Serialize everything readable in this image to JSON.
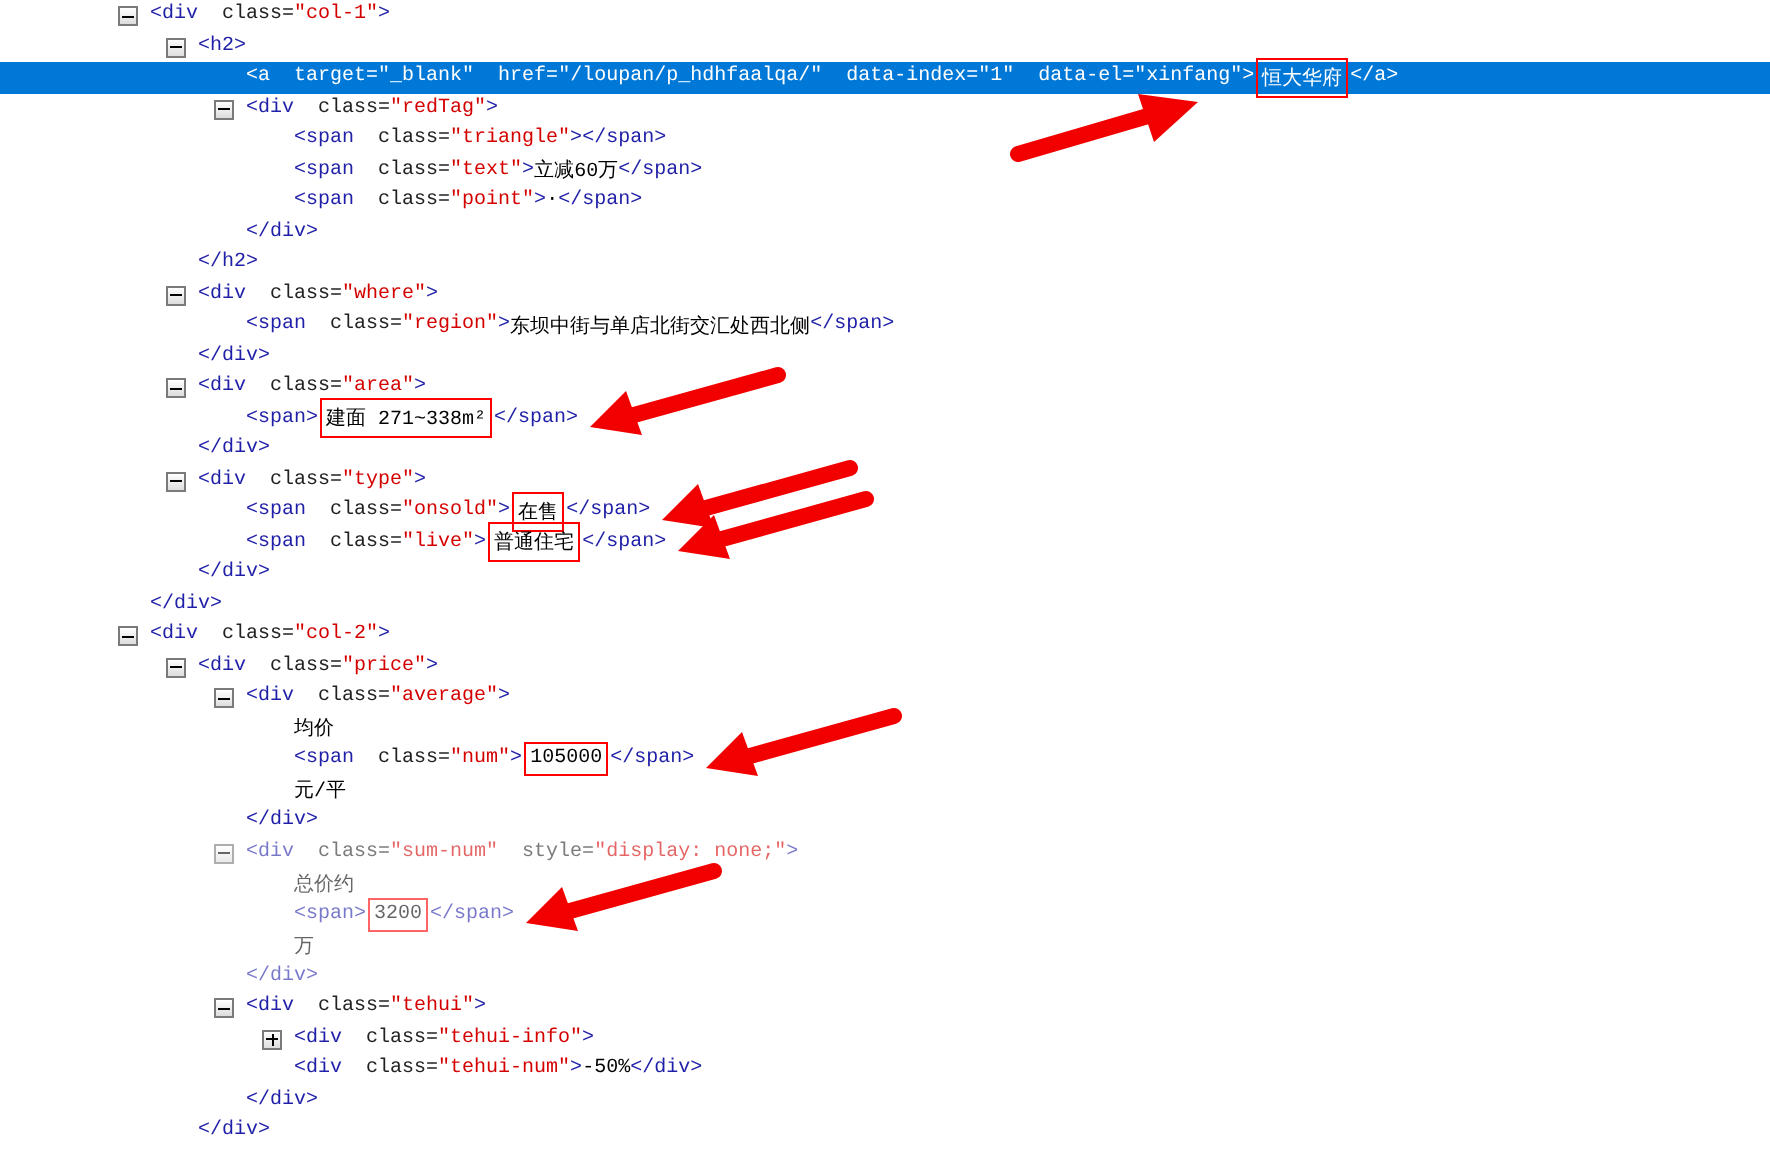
{
  "tree": [
    {
      "selected": false,
      "expanded": true,
      "open": [
        {
          "kind": "tag",
          "text": "<div"
        },
        {
          "kind": "attr",
          "text": "class="
        },
        {
          "kind": "value",
          "text": "\"col-1\""
        },
        {
          "kind": "tag",
          "text": ">"
        }
      ],
      "children": [
        {
          "selected": false,
          "expanded": true,
          "open": [
            {
              "kind": "tag",
              "text": "<h2>"
            }
          ],
          "children": [
            {
              "selected": true,
              "open": [
                {
                  "kind": "tag",
                  "text": "<a"
                },
                {
                  "kind": "attr",
                  "text": "target="
                },
                {
                  "kind": "value",
                  "text": "\"_blank\""
                },
                {
                  "kind": "attr",
                  "text": "href="
                },
                {
                  "kind": "value",
                  "text": "\"/loupan/p_hdhfaalqa/\""
                },
                {
                  "kind": "attr",
                  "text": "data-index="
                },
                {
                  "kind": "value",
                  "text": "\"1\""
                },
                {
                  "kind": "attr",
                  "text": "data-el="
                },
                {
                  "kind": "value",
                  "text": "\"xinfang\""
                },
                {
                  "kind": "tag",
                  "text": ">"
                },
                {
                  "kind": "text",
                  "text": "恒大华府",
                  "boxed": true
                },
                {
                  "kind": "tag",
                  "text": "</a>"
                }
              ]
            },
            {
              "selected": false,
              "expanded": true,
              "open": [
                {
                  "kind": "tag",
                  "text": "<div"
                },
                {
                  "kind": "attr",
                  "text": "class="
                },
                {
                  "kind": "value",
                  "text": "\"redTag\""
                },
                {
                  "kind": "tag",
                  "text": ">"
                }
              ],
              "children": [
                {
                  "selected": false,
                  "open": [
                    {
                      "kind": "tag",
                      "text": "<span"
                    },
                    {
                      "kind": "attr",
                      "text": "class="
                    },
                    {
                      "kind": "value",
                      "text": "\"triangle\""
                    },
                    {
                      "kind": "tag",
                      "text": ">"
                    },
                    {
                      "kind": "tag",
                      "text": "</span>"
                    }
                  ]
                },
                {
                  "selected": false,
                  "open": [
                    {
                      "kind": "tag",
                      "text": "<span"
                    },
                    {
                      "kind": "attr",
                      "text": "class="
                    },
                    {
                      "kind": "value",
                      "text": "\"text\""
                    },
                    {
                      "kind": "tag",
                      "text": ">"
                    },
                    {
                      "kind": "text",
                      "text": "立减60万"
                    },
                    {
                      "kind": "tag",
                      "text": "</span>"
                    }
                  ]
                },
                {
                  "selected": false,
                  "open": [
                    {
                      "kind": "tag",
                      "text": "<span"
                    },
                    {
                      "kind": "attr",
                      "text": "class="
                    },
                    {
                      "kind": "value",
                      "text": "\"point\""
                    },
                    {
                      "kind": "tag",
                      "text": ">"
                    },
                    {
                      "kind": "text",
                      "text": "·"
                    },
                    {
                      "kind": "tag",
                      "text": "</span>"
                    }
                  ]
                }
              ],
              "close": [
                {
                  "kind": "tag",
                  "text": "</div>"
                }
              ]
            }
          ],
          "close": [
            {
              "kind": "tag",
              "text": "</h2>"
            }
          ]
        },
        {
          "selected": false,
          "expanded": true,
          "open": [
            {
              "kind": "tag",
              "text": "<div"
            },
            {
              "kind": "attr",
              "text": "class="
            },
            {
              "kind": "value",
              "text": "\"where\""
            },
            {
              "kind": "tag",
              "text": ">"
            }
          ],
          "children": [
            {
              "selected": false,
              "open": [
                {
                  "kind": "tag",
                  "text": "<span"
                },
                {
                  "kind": "attr",
                  "text": "class="
                },
                {
                  "kind": "value",
                  "text": "\"region\""
                },
                {
                  "kind": "tag",
                  "text": ">"
                },
                {
                  "kind": "text",
                  "text": "东坝中街与单店北街交汇处西北侧"
                },
                {
                  "kind": "tag",
                  "text": "</span>"
                }
              ]
            }
          ],
          "close": [
            {
              "kind": "tag",
              "text": "</div>"
            }
          ]
        },
        {
          "selected": false,
          "expanded": true,
          "open": [
            {
              "kind": "tag",
              "text": "<div"
            },
            {
              "kind": "attr",
              "text": "class="
            },
            {
              "kind": "value",
              "text": "\"area\""
            },
            {
              "kind": "tag",
              "text": ">"
            }
          ],
          "children": [
            {
              "selected": false,
              "arrow": true,
              "open": [
                {
                  "kind": "tag",
                  "text": "<span>"
                },
                {
                  "kind": "text",
                  "text": "建面 271~338m²",
                  "boxed": true
                },
                {
                  "kind": "tag",
                  "text": "</span>"
                }
              ]
            }
          ],
          "close": [
            {
              "kind": "tag",
              "text": "</div>"
            }
          ]
        },
        {
          "selected": false,
          "expanded": true,
          "open": [
            {
              "kind": "tag",
              "text": "<div"
            },
            {
              "kind": "attr",
              "text": "class="
            },
            {
              "kind": "value",
              "text": "\"type\""
            },
            {
              "kind": "tag",
              "text": ">"
            }
          ],
          "children": [
            {
              "selected": false,
              "arrow": true,
              "open": [
                {
                  "kind": "tag",
                  "text": "<span"
                },
                {
                  "kind": "attr",
                  "text": "class="
                },
                {
                  "kind": "value",
                  "text": "\"onsold\""
                },
                {
                  "kind": "tag",
                  "text": ">"
                },
                {
                  "kind": "text",
                  "text": "在售",
                  "boxed": true
                },
                {
                  "kind": "tag",
                  "text": "</span>"
                }
              ]
            },
            {
              "selected": false,
              "arrow": true,
              "open": [
                {
                  "kind": "tag",
                  "text": "<span"
                },
                {
                  "kind": "attr",
                  "text": "class="
                },
                {
                  "kind": "value",
                  "text": "\"live\""
                },
                {
                  "kind": "tag",
                  "text": ">"
                },
                {
                  "kind": "text",
                  "text": "普通住宅",
                  "boxed": true
                },
                {
                  "kind": "tag",
                  "text": "</span>"
                }
              ]
            }
          ],
          "close": [
            {
              "kind": "tag",
              "text": "</div>"
            }
          ]
        }
      ],
      "close": [
        {
          "kind": "tag",
          "text": "</div>"
        }
      ]
    },
    {
      "selected": false,
      "expanded": true,
      "open": [
        {
          "kind": "tag",
          "text": "<div"
        },
        {
          "kind": "attr",
          "text": "class="
        },
        {
          "kind": "value",
          "text": "\"col-2\""
        },
        {
          "kind": "tag",
          "text": ">"
        }
      ],
      "children": [
        {
          "selected": false,
          "expanded": true,
          "open": [
            {
              "kind": "tag",
              "text": "<div"
            },
            {
              "kind": "attr",
              "text": "class="
            },
            {
              "kind": "value",
              "text": "\"price\""
            },
            {
              "kind": "tag",
              "text": ">"
            }
          ],
          "children": [
            {
              "selected": false,
              "hidden": false,
              "expanded": true,
              "open": [
                {
                  "kind": "tag",
                  "text": "<div"
                },
                {
                  "kind": "attr",
                  "text": "class="
                },
                {
                  "kind": "value",
                  "text": "\"average\""
                },
                {
                  "kind": "tag",
                  "text": ">"
                }
              ],
              "children": [
                {
                  "selected": false,
                  "open": [
                    {
                      "kind": "text",
                      "text": "均价"
                    }
                  ]
                },
                {
                  "selected": false,
                  "arrow": true,
                  "open": [
                    {
                      "kind": "tag",
                      "text": "<span"
                    },
                    {
                      "kind": "attr",
                      "text": "class="
                    },
                    {
                      "kind": "value",
                      "text": "\"num\""
                    },
                    {
                      "kind": "tag",
                      "text": ">"
                    },
                    {
                      "kind": "text",
                      "text": "105000",
                      "boxed": true
                    },
                    {
                      "kind": "tag",
                      "text": "</span>"
                    }
                  ]
                },
                {
                  "selected": false,
                  "open": [
                    {
                      "kind": "text",
                      "text": "元/平"
                    }
                  ]
                }
              ],
              "close": [
                {
                  "kind": "tag",
                  "text": "</div>"
                }
              ]
            },
            {
              "selected": false,
              "hidden": true,
              "expanded": true,
              "open": [
                {
                  "kind": "tag",
                  "text": "<div"
                },
                {
                  "kind": "attr",
                  "text": "class="
                },
                {
                  "kind": "value",
                  "text": "\"sum-num\""
                },
                {
                  "kind": "attr",
                  "text": "style="
                },
                {
                  "kind": "value",
                  "text": "\"display: none;\""
                },
                {
                  "kind": "tag",
                  "text": ">"
                }
              ],
              "children": [
                {
                  "selected": false,
                  "open": [
                    {
                      "kind": "text",
                      "text": "总价约"
                    }
                  ]
                },
                {
                  "selected": false,
                  "arrow": true,
                  "open": [
                    {
                      "kind": "tag",
                      "text": "<span>"
                    },
                    {
                      "kind": "text",
                      "text": "3200",
                      "boxed": true
                    },
                    {
                      "kind": "tag",
                      "text": "</span>"
                    }
                  ]
                },
                {
                  "selected": false,
                  "open": [
                    {
                      "kind": "text",
                      "text": "万"
                    }
                  ]
                }
              ],
              "close": [
                {
                  "kind": "tag",
                  "text": "</div>"
                }
              ]
            },
            {
              "selected": false,
              "hidden": false,
              "expanded": true,
              "open": [
                {
                  "kind": "tag",
                  "text": "<div"
                },
                {
                  "kind": "attr",
                  "text": "class="
                },
                {
                  "kind": "value",
                  "text": "\"tehui\""
                },
                {
                  "kind": "tag",
                  "text": ">"
                }
              ],
              "children": [
                {
                  "selected": false,
                  "expanded": false,
                  "open": [
                    {
                      "kind": "tag",
                      "text": "<div"
                    },
                    {
                      "kind": "attr",
                      "text": "class="
                    },
                    {
                      "kind": "value",
                      "text": "\"tehui-info\""
                    },
                    {
                      "kind": "tag",
                      "text": ">"
                    }
                  ]
                },
                {
                  "selected": false,
                  "open": [
                    {
                      "kind": "tag",
                      "text": "<div"
                    },
                    {
                      "kind": "attr",
                      "text": "class="
                    },
                    {
                      "kind": "value",
                      "text": "\"tehui-num\""
                    },
                    {
                      "kind": "tag",
                      "text": ">"
                    },
                    {
                      "kind": "text",
                      "text": "-50%"
                    },
                    {
                      "kind": "tag",
                      "text": "</div>"
                    }
                  ]
                }
              ],
              "close": [
                {
                  "kind": "tag",
                  "text": "</div>"
                }
              ]
            }
          ],
          "close": [
            {
              "kind": "tag",
              "text": "</div>"
            }
          ]
        }
      ]
    }
  ]
}
